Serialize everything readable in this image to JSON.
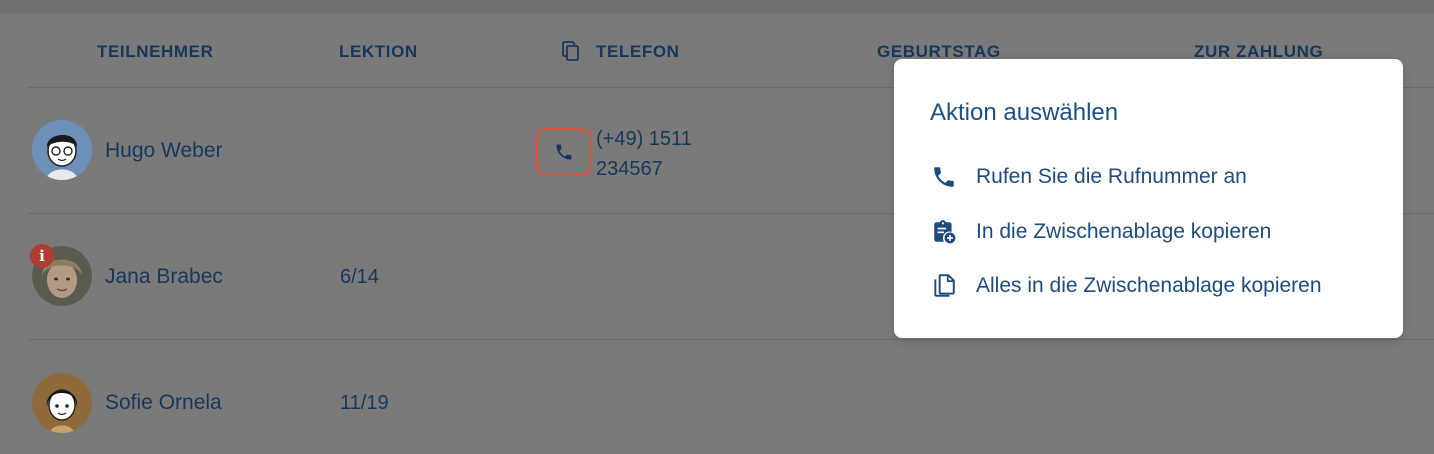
{
  "table": {
    "headers": {
      "teilnehmer": "TEILNEHMER",
      "lektion": "LEKTION",
      "telefon": "TELEFON",
      "geburtstag": "GEBURTSTAG",
      "zur_zahlung": "ZUR ZAHLUNG"
    },
    "rows": [
      {
        "name": "Hugo Weber",
        "lektion": "",
        "phone_line1": "(+49) 1511",
        "phone_line2": "234567"
      },
      {
        "name": "Jana Brabec",
        "lektion": "6/14",
        "badge": "i"
      },
      {
        "name": "Sofie Ornela",
        "lektion": "11/19"
      }
    ]
  },
  "popup": {
    "title": "Aktion auswählen",
    "items": [
      {
        "label": "Rufen Sie die Rufnummer an",
        "icon": "phone-icon"
      },
      {
        "label": "In die Zwischenablage kopieren",
        "icon": "clipboard-plus-icon"
      },
      {
        "label": "Alles in die Zwischenablage kopieren",
        "icon": "copy-all-icon"
      }
    ]
  },
  "colors": {
    "overlay": "#7a7a7a",
    "text_dark": "#16375c",
    "popup_accent": "#1c4f86",
    "highlight": "#d8543b",
    "badge": "#b13d31"
  }
}
